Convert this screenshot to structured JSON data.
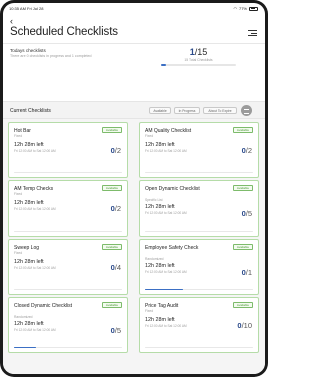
{
  "status_bar": {
    "time": "10:35 AM  Fri Jul 28",
    "battery": "77%"
  },
  "header": {
    "title": "Scheduled Checklists"
  },
  "summary": {
    "label": "Todays checklists",
    "subtitle": "There are 0 checklists in progress and 1 completed",
    "done": "1",
    "total": "/15",
    "total_label": "15 Total Checklists",
    "progress": 0.07
  },
  "section": {
    "title": "Current Checklists",
    "filters": [
      "Available",
      "In Progress",
      "About To Expire"
    ]
  },
  "colors": {
    "accent": "#3b6fc4",
    "available": "#4e9a3b"
  },
  "cards": [
    {
      "name": "Hot Bar",
      "type": "Fixed",
      "badge": "Available",
      "time_left": "12h 28m left",
      "due": "Fri 12:00 AM to Sat 12:00 AM",
      "done": "0",
      "total": "/2",
      "progress": 0
    },
    {
      "name": "AM Quality Checklist",
      "type": "Fixed",
      "badge": "Available",
      "time_left": "12h 28m left",
      "due": "Fri 12:00 AM to Sat 12:00 AM",
      "done": "0",
      "total": "/2",
      "progress": 0
    },
    {
      "name": "AM Temp Checks",
      "type": "Fixed",
      "badge": "Available",
      "time_left": "12h 28m left",
      "due": "Fri 12:00 AM to Sat 12:00 AM",
      "done": "0",
      "total": "/2",
      "progress": 0
    },
    {
      "name": "Open Dynamic Checklist",
      "type": "Specific List",
      "badge": "Available",
      "time_left": "12h 28m left",
      "due": "Fri 12:00 AM to Sat 12:00 AM",
      "done": "0",
      "total": "/5",
      "progress": 0
    },
    {
      "name": "Sweep Log",
      "type": "Fixed",
      "badge": "Available",
      "time_left": "12h 28m left",
      "due": "Fri 12:00 AM to Sat 12:00 AM",
      "done": "0",
      "total": "/4",
      "progress": 0
    },
    {
      "name": "Employee Safety Check",
      "type": "Randomized",
      "badge": "Available",
      "time_left": "12h 28m left",
      "due": "Fri 12:00 AM to Sat 12:00 AM",
      "done": "0",
      "total": "/1",
      "progress": 0.35
    },
    {
      "name": "Closed Dynamic Checklist",
      "type": "Randomized",
      "badge": "Available",
      "time_left": "12h 28m left",
      "due": "Fri 12:00 AM to Sat 12:00 AM",
      "done": "0",
      "total": "/5",
      "progress": 0.2
    },
    {
      "name": "Price Tag Audit",
      "type": "Fixed",
      "badge": "Available",
      "time_left": "12h 28m left",
      "due": "Fri 12:00 AM to Sat 12:00 AM",
      "done": "0",
      "total": "/10",
      "progress": 0
    }
  ]
}
